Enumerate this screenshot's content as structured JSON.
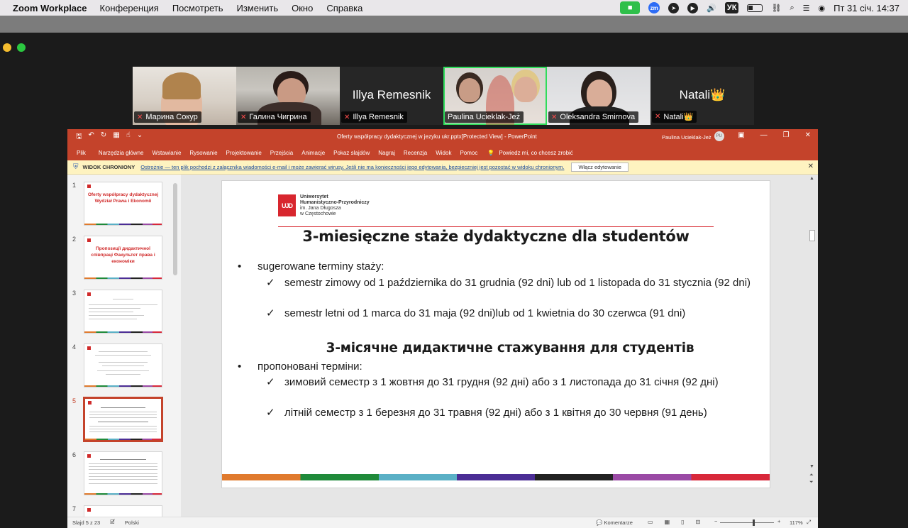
{
  "menubar": {
    "app_name": "Zoom Workplace",
    "items": [
      "Конференция",
      "Посмотреть",
      "Изменить",
      "Окно",
      "Справка"
    ],
    "zoom_badge": "zm",
    "input_source": "УК",
    "datetime": "Пт 31 січ.  14:37"
  },
  "gallery": {
    "participants": [
      {
        "name": "Марина Сокур",
        "muted": true,
        "video": true
      },
      {
        "name": "Галина Чигрина",
        "muted": true,
        "video": true
      },
      {
        "name": "Illya Remesnik",
        "display_name": "Illya Remesnik",
        "muted": true,
        "video": false
      },
      {
        "name": "Paulina Ucieklak-Jeż",
        "muted": false,
        "video": true,
        "active_speaker": true
      },
      {
        "name": "Oleksandra Smirnova",
        "muted": true,
        "video": true
      },
      {
        "name": "Natali👑",
        "display_name": "Natali👑",
        "muted": true,
        "video": false
      }
    ]
  },
  "ppt": {
    "window_title": "Oferty współpracy dydaktycznej  w jezyku ukr.pptx[Protected View]  -  PowerPoint",
    "user_name": "Paulina Ucieklak-Jeż",
    "user_initials": "PU",
    "ribbon_tabs": [
      "Plik",
      "Narzędzia główne",
      "Wstawianie",
      "Rysowanie",
      "Projektowanie",
      "Przejścia",
      "Animacje",
      "Pokaz slajdów",
      "Nagraj",
      "Recenzja",
      "Widok",
      "Pomoc"
    ],
    "tell_me": "Powiedz mi, co chcesz zrobić",
    "protected_view": {
      "title": "WIDOK CHRONIONY",
      "message": "Ostrożnie — ten plik pochodzi z załącznika wiadomości e-mail i może zawierać wirusy. Jeśli nie ma konieczności jego edytowania, bezpieczniej jest pozostać w widoku chronionym.",
      "button": "Włącz edytowanie"
    },
    "thumbnails": [
      {
        "num": "1",
        "title": "Oferty współpracy dydaktycznej Wydział Prawa i Ekonomii"
      },
      {
        "num": "2",
        "title": "Пропозиції дидактичної співпраці Факультет права і економіки"
      },
      {
        "num": "3",
        "title": ""
      },
      {
        "num": "4",
        "title": ""
      },
      {
        "num": "5",
        "title": "",
        "selected": true
      },
      {
        "num": "6",
        "title": ""
      },
      {
        "num": "7",
        "title": ""
      }
    ],
    "slide": {
      "logo_initials": "UJD",
      "university_lines": [
        "Uniwersytet",
        "Humanistyczno-Przyrodniczy",
        "im. Jana Długosza",
        "w Częstochowie"
      ],
      "title_pl": "3-miesięczne staże dydaktyczne dla studentów",
      "bullet_pl": "sugerowane terminy staży:",
      "checks_pl": [
        "semestr zimowy od 1 października do 31 grudnia (92 dni) lub od 1 listopada do 31 stycznia (92 dni)",
        "semestr letni od 1 marca do 31 maja (92 dni)lub od 1 kwietnia do 30 czerwca (91 dni)"
      ],
      "title_uk": "3-місячне дидактичне стажування для студентів",
      "bullet_uk": "пропоновані терміни:",
      "checks_uk": [
        "зимовий семестр  з 1 жовтня до 31 грудня (92 дні) або з 1 листопада до 31 січня (92 дні)",
        "літній семестр з 1 березня до 31 травня (92 дні) або з 1 квітня до 30 червня (91 день)"
      ],
      "bullet_symbol": "•",
      "check_symbol": "✓"
    },
    "status": {
      "slide_counter": "Slajd 5 z 23",
      "language": "Polski",
      "comments": "Komentarze",
      "zoom": "117%"
    }
  }
}
